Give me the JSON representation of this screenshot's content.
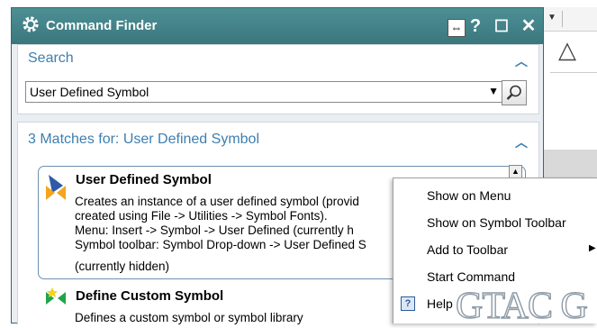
{
  "dialog": {
    "title": "Command Finder",
    "help_label": "?",
    "maximize_label": "☐",
    "close_label": "✕"
  },
  "search_section": {
    "title": "Search",
    "query_value": "User Defined Symbol"
  },
  "results_section": {
    "title": "3 Matches for: User Defined Symbol",
    "results": [
      {
        "title": "User Defined Symbol",
        "description": [
          "Creates an instance of a user defined symbol (provid",
          "created using File -> Utilities -> Symbol Fonts).",
          "Menu: Insert -> Symbol -> User Defined (currently h",
          "Symbol toolbar: Symbol Drop-down -> User Defined S",
          "(currently hidden)"
        ]
      },
      {
        "title": "Define Custom Symbol",
        "description": [
          "Defines a custom symbol or symbol library"
        ]
      }
    ]
  },
  "context_menu": {
    "items": [
      "Show on Menu",
      "Show on Symbol Toolbar",
      "Add to Toolbar",
      "Start Command",
      "Help"
    ]
  },
  "watermark": "GTAC G",
  "colors": {
    "titlebar": "#3f7f85",
    "section_title": "#3d7fb0",
    "card_border": "#6f8fb0"
  }
}
